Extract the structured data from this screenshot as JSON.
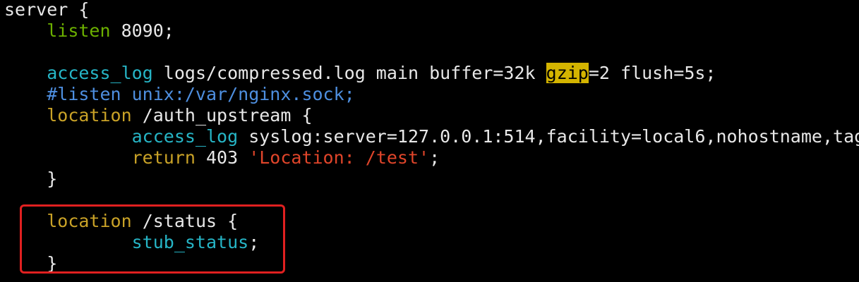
{
  "editor": {
    "lines": [
      {
        "indent": "",
        "segments": [
          {
            "text": "server {",
            "style": "plain"
          }
        ]
      },
      {
        "indent": "    ",
        "segments": [
          {
            "text": "listen",
            "style": "kw-green"
          },
          {
            "text": " 8090;",
            "style": "plain"
          }
        ]
      },
      {
        "indent": "",
        "segments": []
      },
      {
        "indent": "    ",
        "segments": [
          {
            "text": "access_log",
            "style": "kw-teal"
          },
          {
            "text": " logs/compressed.log main buffer=32k ",
            "style": "plain"
          },
          {
            "text": "gzip",
            "style": "hl-search"
          },
          {
            "text": "=2 flush=5s;",
            "style": "plain"
          }
        ]
      },
      {
        "indent": "    ",
        "segments": [
          {
            "text": "#listen unix:/var/nginx.sock;",
            "style": "kw-blue"
          }
        ]
      },
      {
        "indent": "    ",
        "segments": [
          {
            "text": "location",
            "style": "kw-gold"
          },
          {
            "text": " /auth_upstream {",
            "style": "plain"
          }
        ]
      },
      {
        "indent": "            ",
        "segments": [
          {
            "text": "access_log",
            "style": "kw-teal"
          },
          {
            "text": " syslog:server=127.0.0.1:514,facility=local6,nohostname,tag",
            "style": "plain"
          }
        ]
      },
      {
        "indent": "            ",
        "segments": [
          {
            "text": "return",
            "style": "kw-gold"
          },
          {
            "text": " 403 ",
            "style": "plain"
          },
          {
            "text": "'Location: /test'",
            "style": "str-red"
          },
          {
            "text": ";",
            "style": "plain"
          }
        ]
      },
      {
        "indent": "    ",
        "segments": [
          {
            "text": "}",
            "style": "plain"
          }
        ]
      },
      {
        "indent": "",
        "segments": []
      },
      {
        "indent": "    ",
        "segments": [
          {
            "text": "location",
            "style": "kw-gold"
          },
          {
            "text": " /status {",
            "style": "plain"
          }
        ]
      },
      {
        "indent": "            ",
        "segments": [
          {
            "text": "stub_status",
            "style": "kw-teal"
          },
          {
            "text": ";",
            "style": "plain"
          }
        ]
      },
      {
        "indent": "    ",
        "segments": [
          {
            "text": "}",
            "style": "plain"
          }
        ]
      }
    ],
    "search_highlight": "gzip",
    "annotation_box_color": "#e02020"
  }
}
